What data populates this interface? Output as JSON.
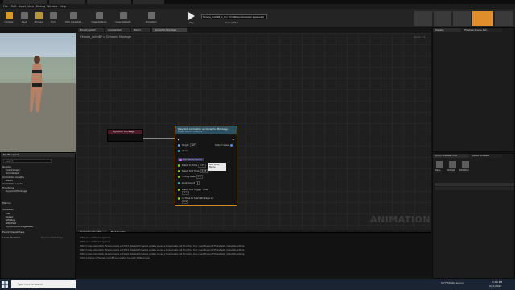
{
  "window_tabs": [
    "",
    "",
    "",
    "",
    "",
    ""
  ],
  "menu": [
    "File",
    "Edit",
    "Asset",
    "View",
    "Debug",
    "Window",
    "Help"
  ],
  "toolbar": {
    "buttons": [
      "Compile",
      "Save",
      "Browse",
      "Find",
      "Hide Unrelated",
      "Class Settings",
      "Class Defaults",
      "Simulation",
      "Play"
    ],
    "debug_filter": "Female_AnimBP_C_0 in ThirdPersonCharacter (spawned)",
    "debug_filter_label": "Debug Filter"
  },
  "mode_tabs": [
    "Skeleton",
    "Mesh",
    "Animation",
    "Blueprint",
    "Physics"
  ],
  "graph_tabs": [
    "Event Graph",
    "AnimGraph",
    "Blend",
    "Dynamic Montage"
  ],
  "breadcrumb": {
    "root": "Female_AnimBP",
    "current": "Dynamic Montage"
  },
  "zoom": "Zoom 1:1",
  "my_blueprint": {
    "title": "My Blueprint",
    "search_placeholder": "Search",
    "sections": [
      "Graphs",
      "Animation Graphs",
      "Animation Layers",
      "Functions",
      "Macros",
      "Variables",
      "Event Dispatchers",
      "Local Variables"
    ],
    "items": [
      "EventGraph",
      "AnimGraph",
      "Blend",
      "DynamicMontage",
      "Idle",
      "Speed",
      "IsFalling",
      "IsSlotSet",
      "DynamicMontageAsset"
    ],
    "local_vars_hint": "Dynamic Montage"
  },
  "nodes": {
    "dynamic_montage": {
      "title": "Dynamic Montage"
    },
    "play_slot": {
      "title": "Play Slot Animation as Dynamic Montage",
      "subtitle": "Target is Anim Instance",
      "pins_in": [
        "Target",
        "self",
        "Asset",
        "Slot Node Name",
        "Blend In Time",
        "0.25",
        "Blend Out Time",
        "0.25",
        "In Play Rate",
        "1.0",
        "Loop Count",
        "1",
        "Blend Out Trigger Time",
        "-1.0",
        "In Time to Start Montage At",
        "0.0"
      ],
      "pins_out": [
        "Return Value"
      ],
      "tooltip": "Slot Node Name"
    }
  },
  "watermark": "ANIMATION",
  "log_tabs": [
    "Compiler Results",
    "Find Results"
  ],
  "log_lines": [
    "[Info] one visible but ignored",
    "[Info] one visible but ignored",
    "[Warn] uses potentially thread-unsafe call Print. Disable threaded update or use a thread-safe call. Function may need BlueprintThreadSafe metadata adding.",
    "[Warn] uses potentially thread-unsafe call Print. Disable threaded update or use a thread-safe call. Function may need BlueprintThreadSafe metadata adding.",
    "[Warn] uses potentially thread-unsafe call Print. Disable threaded update or use a thread-safe call. Function may need BlueprintThreadSafe metadata adding.",
    "[Info] Compile of Female_AnimBP successful, but with 3 Warning(s)"
  ],
  "right_panels": {
    "details": "Details",
    "preview_settings": "Preview Scene Set...",
    "asset_browser": "Anim Preview Edit",
    "asset_details": "Asset Browser",
    "buttons": [
      "Save",
      "Edit Def",
      "Edit Shar"
    ]
  },
  "taskbar": {
    "search_placeholder": "Type here to search",
    "weather": "56°F Mostly sunny",
    "time": "1:19 PM",
    "date": "2/11/2022"
  }
}
